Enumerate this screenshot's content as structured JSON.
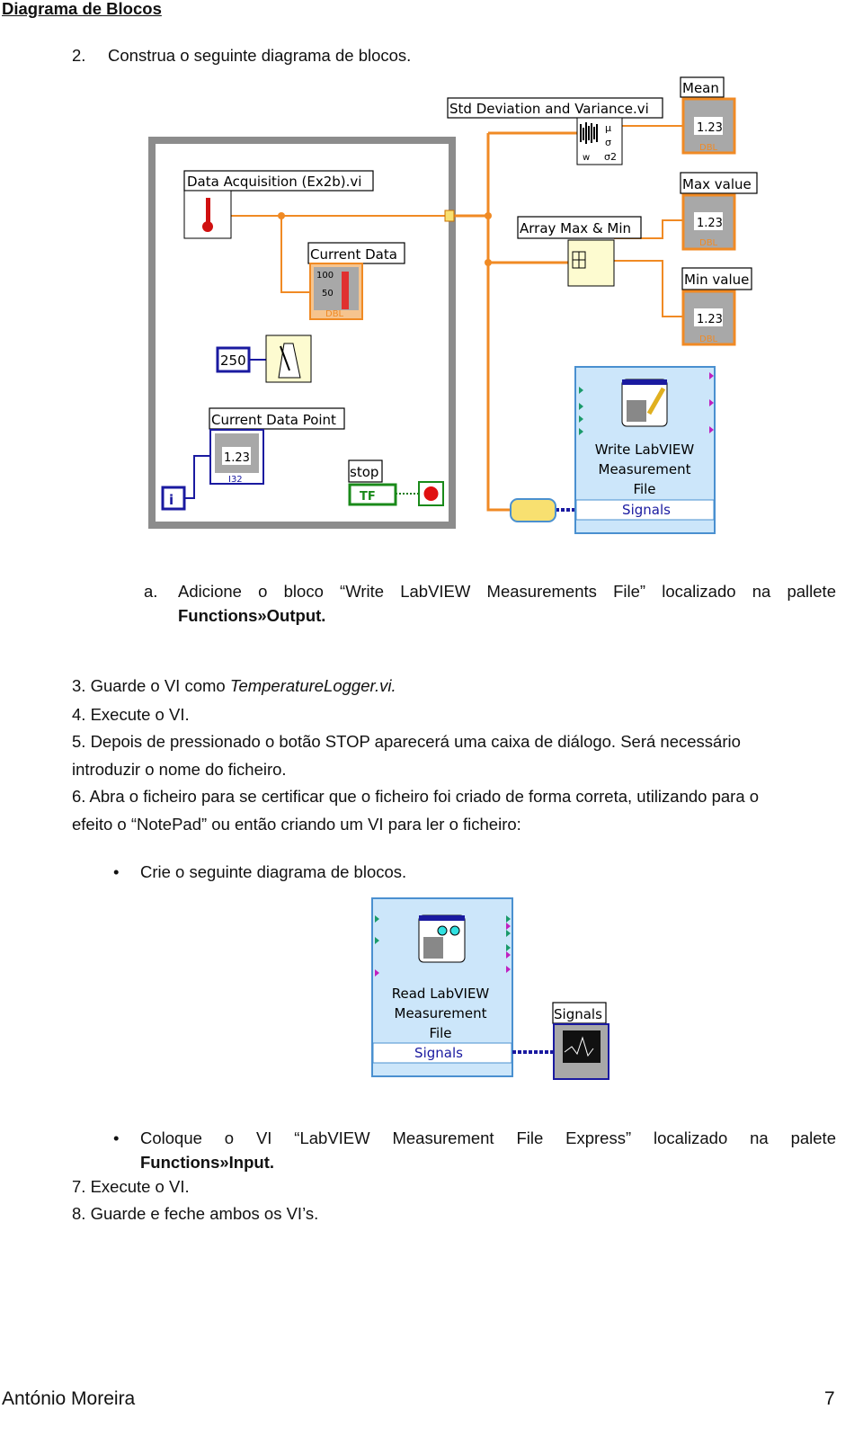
{
  "heading": "Diagrama de Blocos",
  "step2": {
    "num": "2.",
    "text": "Construa o seguinte diagrama de blocos."
  },
  "diagram1": {
    "data_acquisition": "Data Acquisition (Ex2b).vi",
    "current_data": "Current Data",
    "thermo_ticks": [
      "100",
      "50"
    ],
    "dbl": "DBL",
    "i32": "I32",
    "wait_ms": "250",
    "current_data_point": "Current Data Point",
    "numeric_value": "1.23",
    "iteration": "i",
    "stop": "stop",
    "tf": "TF",
    "std_dev": "Std Deviation and Variance.vi",
    "std_outputs": [
      "μ",
      "σ",
      "σ2"
    ],
    "std_input": "w",
    "mean": "Mean",
    "array_max_min": "Array Max & Min",
    "max_value": "Max value",
    "min_value": "Min value",
    "write_block": [
      "Write LabVIEW",
      "Measurement",
      "File"
    ],
    "signals": "Signals",
    "wire_color": "#f08a24",
    "loop_color": "#8c8c8c",
    "express_color": "#cce6fa"
  },
  "step_a": {
    "num": "a.",
    "text": "Adicione o bloco “Write LabVIEW Measurements File” localizado na pallete",
    "path": "Functions»Output."
  },
  "step3": {
    "text": "3. Guarde o VI como ",
    "file": "TemperatureLogger.vi."
  },
  "step4": "4. Execute o VI.",
  "step5": [
    "5. Depois de pressionado o botão STOP aparecerá uma caixa de diálogo. Será necessário",
    "introduzir o nome do ficheiro."
  ],
  "step6": [
    "6. Abra o ficheiro para se certificar que o ficheiro foi criado de forma correta, utilizando para o",
    "efeito o “NotePad” ou então criando um VI para ler o ficheiro:"
  ],
  "bullet1": "Crie o seguinte diagrama de blocos.",
  "diagram2": {
    "read_block": [
      "Read LabVIEW",
      "Measurement",
      "File"
    ],
    "signals": "Signals",
    "graph_label": "Signals"
  },
  "bullet2": {
    "text": "Coloque o VI “LabVIEW Measurement File Express” localizado na palete",
    "path": "Functions»Input."
  },
  "step7": "7. Execute o VI.",
  "step8": "8. Guarde e feche ambos os VI’s.",
  "footer": {
    "author": "António Moreira",
    "page": "7"
  }
}
